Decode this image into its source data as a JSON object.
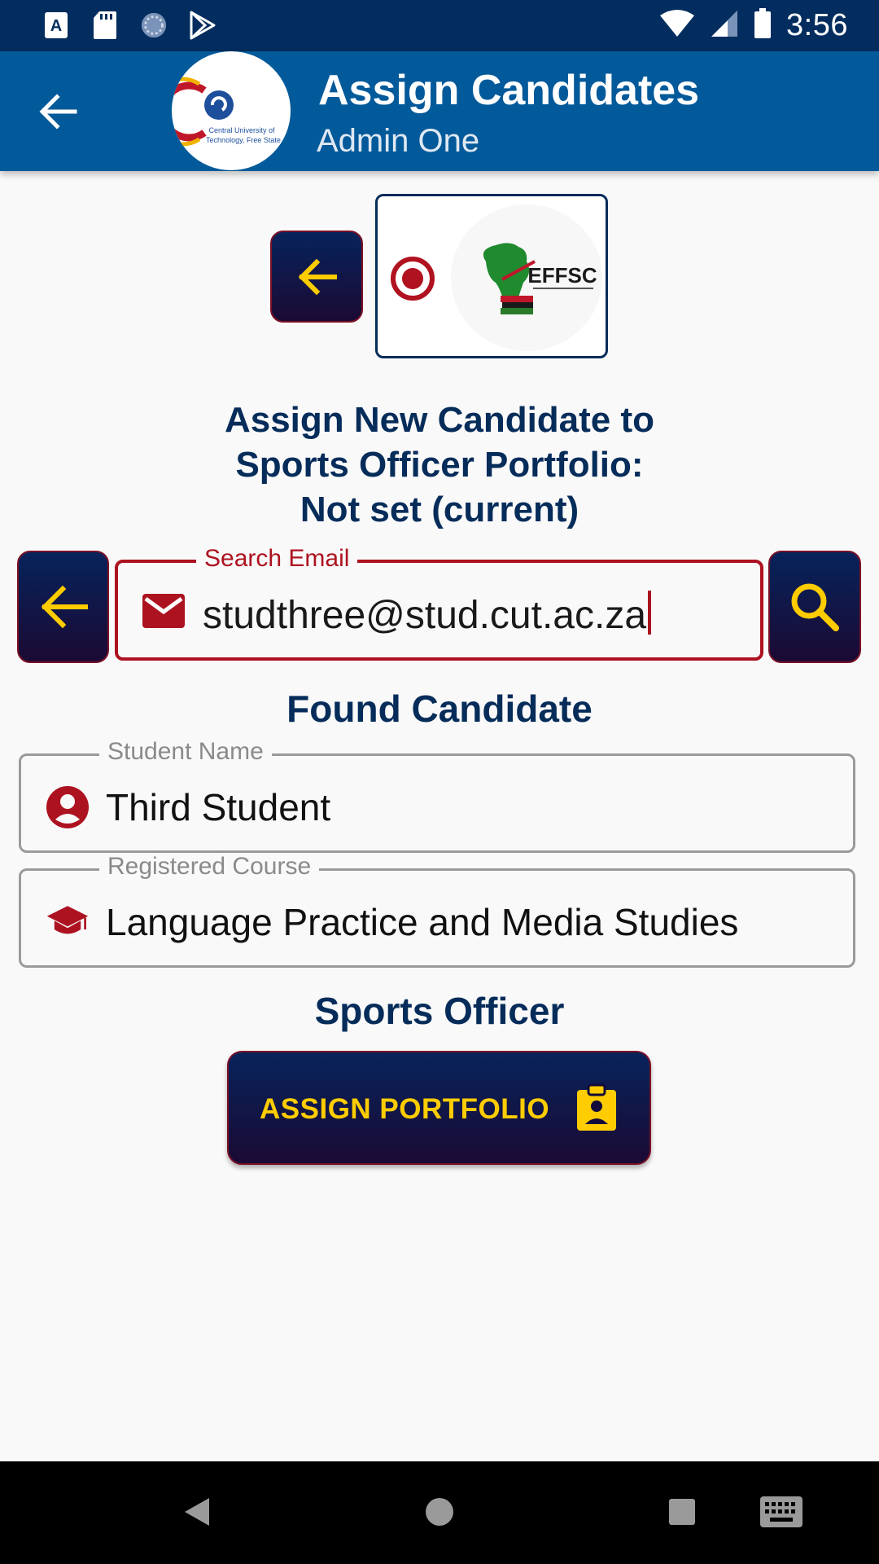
{
  "status_bar": {
    "time": "3:56",
    "left_icons": [
      "text-a-icon",
      "sd-card-icon",
      "loading-icon",
      "play-store-icon"
    ],
    "right_icons": [
      "wifi-icon",
      "signal-icon",
      "battery-icon"
    ]
  },
  "app_bar": {
    "title": "Assign Candidates",
    "subtitle": "Admin One",
    "logo_text_1": "Central University of",
    "logo_text_2": "Technology, Free State"
  },
  "party": {
    "logo_text": "EFFSC",
    "selected": true
  },
  "assign_heading": {
    "line1": "Assign New Candidate to",
    "line2": "Sports Officer Portfolio:",
    "line3": "Not set (current)"
  },
  "search": {
    "label": "Search Email",
    "value": "studthree@stud.cut.ac.za"
  },
  "found": {
    "heading": "Found Candidate",
    "student_name_label": "Student Name",
    "student_name": "Third Student",
    "course_label": "Registered Course",
    "course": "Language Practice and Media Studies"
  },
  "portfolio": {
    "heading": "Sports Officer",
    "assign_label": "ASSIGN PORTFOLIO"
  },
  "colors": {
    "primary": "#035a9a",
    "status_bar": "#022d5e",
    "accent_red": "#ad1220",
    "accent_yellow": "#ffcc00",
    "heading_navy": "#062c5a"
  }
}
